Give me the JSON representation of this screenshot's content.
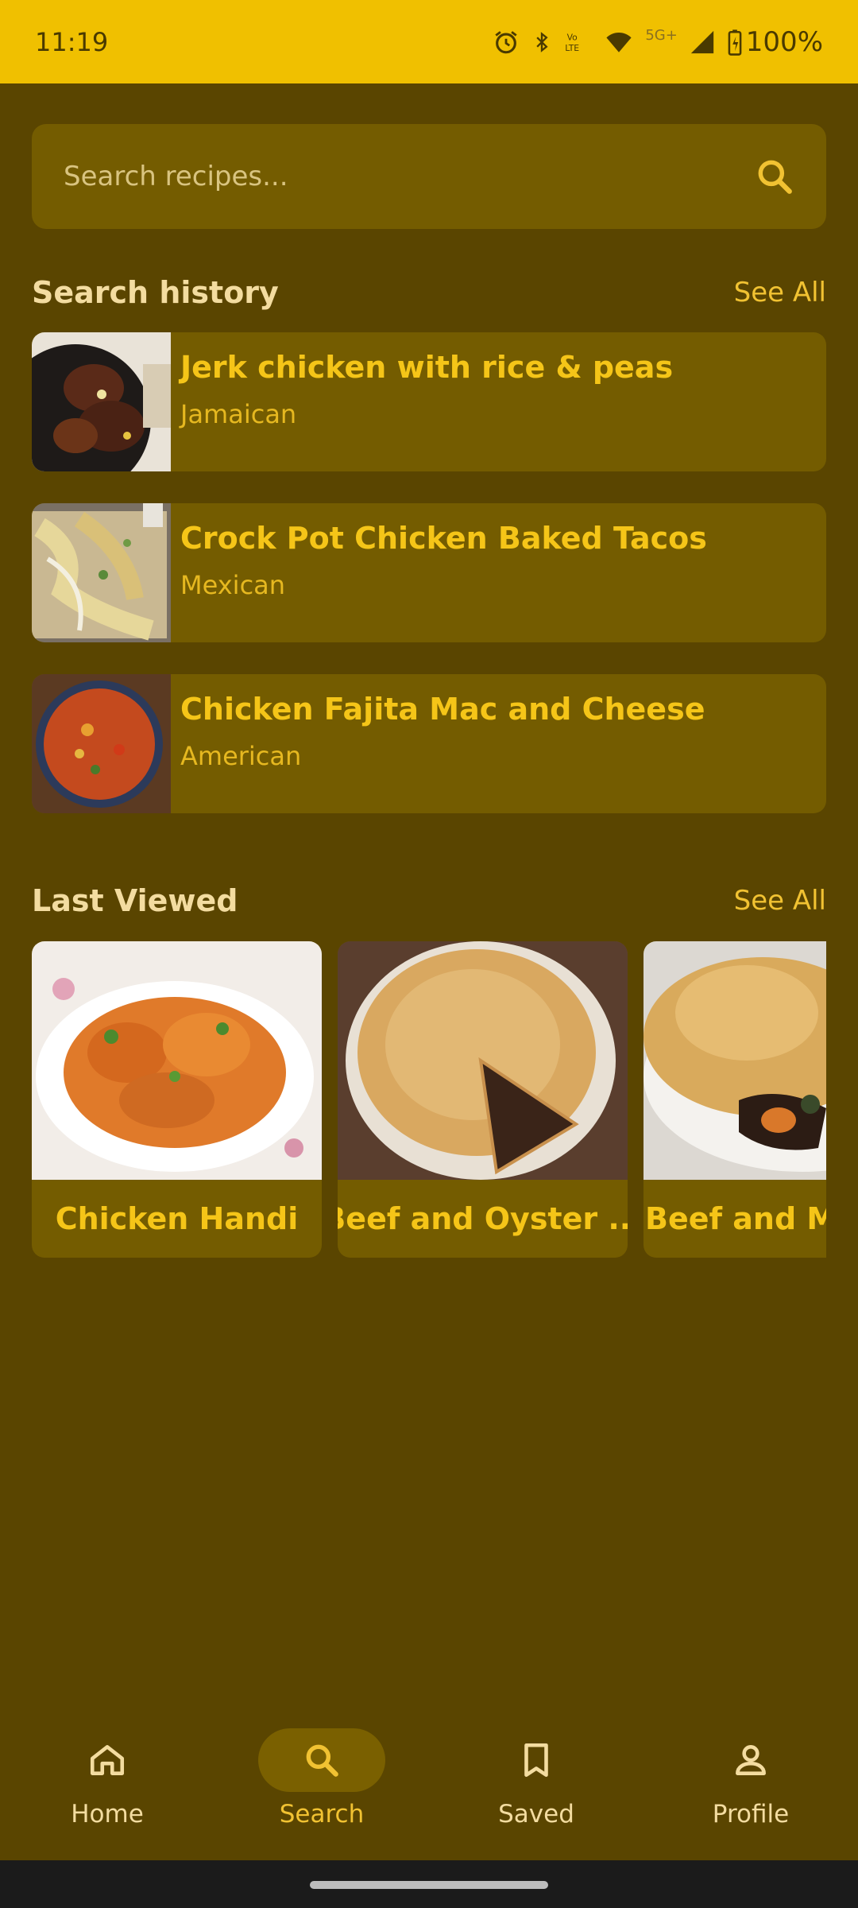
{
  "status_bar": {
    "time": "11:19",
    "battery": "100%",
    "network": "5G+",
    "icons": [
      "alarm-icon",
      "bluetooth-icon",
      "volte-icon",
      "wifi-icon",
      "signal-icon",
      "battery-charging-icon"
    ]
  },
  "search": {
    "placeholder": "Search recipes..."
  },
  "search_history": {
    "title": "Search history",
    "see_all": "See All",
    "items": [
      {
        "title": "Jerk chicken with rice & peas",
        "cuisine": "Jamaican"
      },
      {
        "title": "Crock Pot Chicken Baked Tacos",
        "cuisine": "Mexican"
      },
      {
        "title": "Chicken Fajita Mac and Cheese",
        "cuisine": "American"
      }
    ]
  },
  "last_viewed": {
    "title": "Last Viewed",
    "see_all": "See All",
    "items": [
      {
        "title": "Chicken Handi"
      },
      {
        "title": "Beef and Oyster ..."
      },
      {
        "title": "Beef and Mu"
      }
    ]
  },
  "bottom_nav": {
    "items": [
      {
        "label": "Home",
        "icon": "home-icon"
      },
      {
        "label": "Search",
        "icon": "search-icon",
        "active": true
      },
      {
        "label": "Saved",
        "icon": "bookmark-icon"
      },
      {
        "label": "Profile",
        "icon": "person-icon"
      }
    ]
  },
  "colors": {
    "background": "#5a4500",
    "status_bar": "#f0c000",
    "card": "#745c00",
    "accent": "#f5c518"
  }
}
